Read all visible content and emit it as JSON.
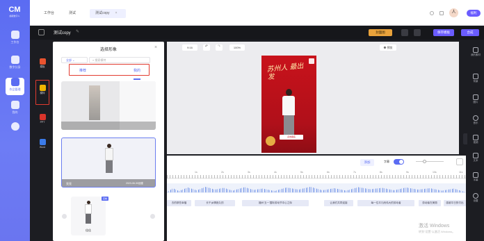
{
  "colors": {
    "brand": "#5b6cf2",
    "accent": "#6a5cff",
    "warning": "#e9a23b",
    "highlight": "#e23b2f",
    "bg": "#1c1d22"
  },
  "app": {
    "logo": "CM",
    "logo_sub": "超级数字人"
  },
  "main_nav": [
    {
      "label": "工作台",
      "icon": "workbench-icon"
    },
    {
      "label": "数字分身",
      "icon": "avatar-icon"
    },
    {
      "label": "作品管理",
      "icon": "works-icon"
    },
    {
      "label": "我的",
      "icon": "me-icon"
    },
    {
      "label": "",
      "icon": "tool-icon"
    }
  ],
  "tabs": [
    "工作台",
    "测试",
    "测试copy"
  ],
  "tab_close": "×",
  "user": {
    "avatar": "人",
    "button": "福利"
  },
  "editor": {
    "title": "测试copy",
    "edit_icon": "✎",
    "btn_draft": "封面图",
    "btn_save": "保存模板",
    "btn_done": "合成"
  },
  "tools": [
    {
      "label": "模板",
      "icon": "template-icon",
      "color": "#e8532f"
    },
    {
      "label": "模特",
      "icon": "model-icon",
      "color": "#f0b400"
    },
    {
      "label": "PPT",
      "icon": "ppt-icon",
      "color": "#d8342b"
    },
    {
      "label": "Word",
      "icon": "word-icon",
      "color": "#3b7be9"
    }
  ],
  "panel": {
    "title": "选择形象",
    "close": "×",
    "filter": "全部",
    "search_placeholder": "搜索模特",
    "tab_recommend": "推荐",
    "tab_mine": "我的",
    "items": [
      {
        "name": "",
        "date": ""
      },
      {
        "name": "亮亮",
        "date": "2023-06-30创建"
      },
      {
        "name": "佳佳",
        "date": ""
      }
    ],
    "badge": "定制"
  },
  "canvas_toolbar": {
    "ratio": "9:16",
    "undo": "↶",
    "redo": "↷",
    "zoom": "100%",
    "preview": "预览"
  },
  "poster": {
    "headline": "苏州人 最出发",
    "button": "点击报名"
  },
  "timeline": {
    "add_label": "添加",
    "mode": "字幕",
    "ruler": [
      "1s",
      "2s",
      "3s",
      "4s",
      "5s",
      "6s",
      "7s",
      "8s",
      "9s",
      "10s",
      "11s"
    ],
    "segments": [
      "去的那些幸福",
      "长干乡情悠久的",
      "福州'五一'国际劳动节中心之际",
      "让我们共同迎接",
      "每一位平凡而伟大的劳动者",
      "劳动者在美丽",
      "感谢平日的付出"
    ]
  },
  "right_sidebar": [
    "我的素材",
    "背景",
    "图片",
    "音乐",
    "视频",
    "文本",
    "字幕",
    "设置"
  ],
  "watermark": {
    "line1": "激活 Windows",
    "line2": "转到\"设置\"以激活 Windows。"
  }
}
